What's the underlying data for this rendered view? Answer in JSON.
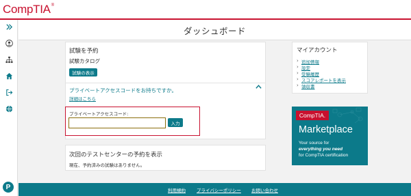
{
  "brand": {
    "logo_text": "CompTIA",
    "logo_mark": "®"
  },
  "page": {
    "title": "ダッシュボード"
  },
  "sidebar": {
    "icons": [
      "expand-icon",
      "user-icon",
      "sitemap-icon",
      "home-icon",
      "sign-out-icon",
      "globe-icon"
    ]
  },
  "schedule_card": {
    "title": "試験を予約",
    "catalog_label": "試験カタログ",
    "view_exams_button": "試験の表示",
    "access_question": "プライベートアクセスコードをお持ちですか。",
    "details_link": "詳細はこちら",
    "access_code_label": "プライベートアクセスコード:",
    "access_code_value": "",
    "submit_button": "入力"
  },
  "next_card": {
    "title": "次回のテストセンターの予約を表示",
    "empty_message": "現在、予約済みの試験はありません。"
  },
  "account": {
    "title": "マイアカウント",
    "links": [
      "追加情報",
      "設定",
      "受験履歴",
      "スコアレポートを表示",
      "領収書"
    ]
  },
  "ad": {
    "badge": "CompTIA.",
    "title": "Marketplace",
    "line1": "Your source for",
    "line2": "everything you need",
    "line3": "for CompTIA certification"
  },
  "footer": {
    "links": [
      "利用規約",
      "プライバシーポリシー",
      "お問い合わせ"
    ]
  },
  "colors": {
    "brand_red": "#c8102e",
    "teal": "#0c7a8a"
  }
}
